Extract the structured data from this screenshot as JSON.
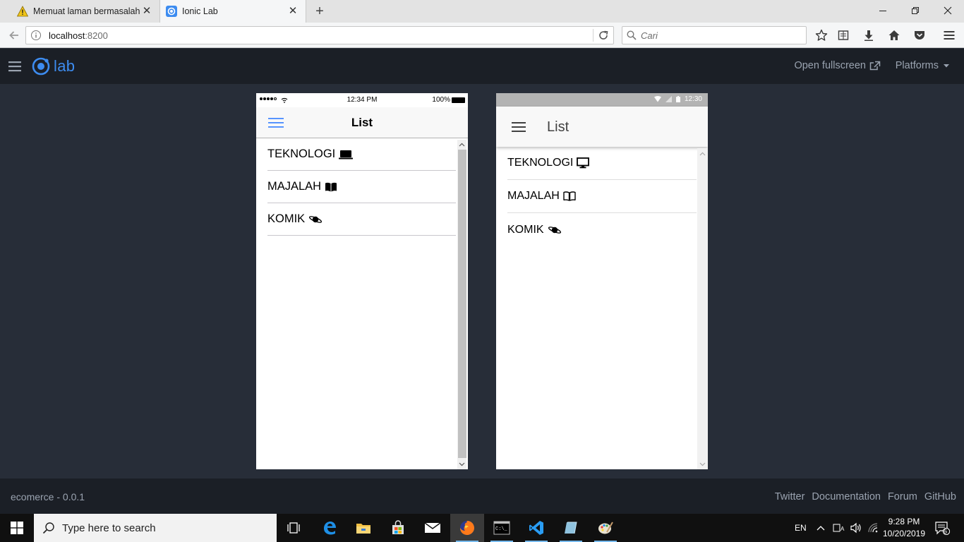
{
  "browser": {
    "tabs": [
      {
        "label": "Memuat laman bermasalah",
        "icon": "warning-icon",
        "active": false
      },
      {
        "label": "Ionic Lab",
        "icon": "ionic-icon",
        "active": true
      }
    ],
    "url_host": "localhost",
    "url_port": ":8200",
    "search_placeholder": "Cari"
  },
  "lab": {
    "logo_text": "lab",
    "open_fullscreen": "Open fullscreen",
    "platforms": "Platforms",
    "version": "ecomerce - 0.0.1",
    "footer_links": [
      "Twitter",
      "Documentation",
      "Forum",
      "GitHub"
    ]
  },
  "ios": {
    "status_time": "12:34 PM",
    "battery": "100%",
    "title": "List",
    "items": [
      {
        "label": "TEKNOLOGI",
        "icon": "laptop-icon"
      },
      {
        "label": "MAJALAH",
        "icon": "book-icon"
      },
      {
        "label": "KOMIK",
        "icon": "planet-icon"
      }
    ]
  },
  "android": {
    "status_time": "12:30",
    "title": "List",
    "items": [
      {
        "label": "TEKNOLOGI",
        "icon": "desktop-icon"
      },
      {
        "label": "MAJALAH",
        "icon": "book-outline-icon"
      },
      {
        "label": "KOMIK",
        "icon": "planet-icon"
      }
    ]
  },
  "taskbar": {
    "search_placeholder": "Type here to search",
    "language": "EN",
    "time": "9:28 PM",
    "date": "10/20/2019",
    "notification_count": "6"
  },
  "colors": {
    "ionic_blue": "#3d8cf0",
    "lab_bg": "#272d38",
    "lab_header": "#1b1f26"
  }
}
